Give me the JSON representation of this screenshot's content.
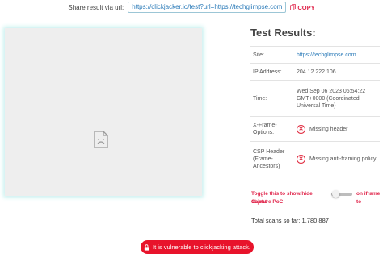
{
  "share": {
    "label": "Share result via url:",
    "url": "https://clickjacker.io/test?url=https://techglimpse.com",
    "copy_label": "COPY"
  },
  "results": {
    "title": "Test Results:",
    "site_label": "Site:",
    "site_value": "https://techglimpse.com",
    "ip_label": "IP Address:",
    "ip_value": "204.12.222.106",
    "time_label": "Time:",
    "time_value": "Wed Sep 06 2023 06:54:22 GMT+0000 (Coordinated Universal Time)",
    "xframe_label": "X-Frame-Options:",
    "xframe_value": "Missing header",
    "csp_label": "CSP Header (Frame-Ancestors)",
    "csp_value": "Missing anti-framing policy"
  },
  "toggle": {
    "text_left": "Toggle this to show/hide object",
    "text_right": "on iframe to",
    "text_bottom": "Capture PoC",
    "checked": false
  },
  "total": {
    "label": "Total scans so far:",
    "value": "1,780,887"
  },
  "banner": {
    "text": "It is vulnerable to clickjacking attack."
  },
  "colors": {
    "accent_red": "#e8132b",
    "link_blue": "#2a7ab8",
    "frame_glow": "#c8f1ef"
  },
  "icons": [
    "copy-icon",
    "broken-document-icon",
    "error-x-icon",
    "lock-icon"
  ]
}
